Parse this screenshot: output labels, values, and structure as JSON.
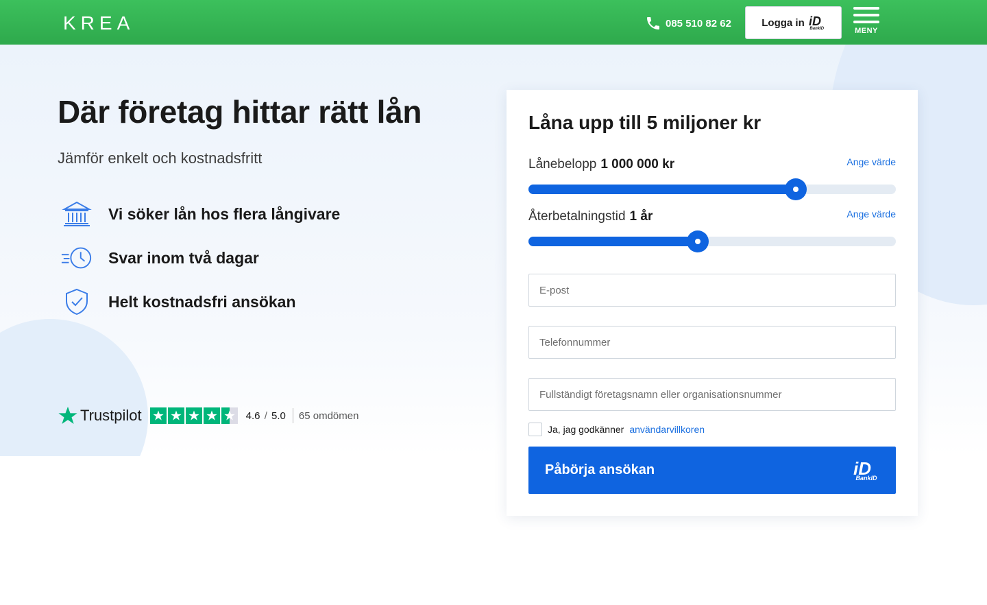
{
  "header": {
    "logo": "KREA",
    "phone": "085 510 82 62",
    "login_label": "Logga in",
    "login_badge_text": "BankID",
    "menu_label": "MENY"
  },
  "hero": {
    "title": "Där företag hittar rätt lån",
    "subtitle": "Jämför enkelt och kostnadsfritt",
    "features": [
      {
        "icon": "bank-icon",
        "text": "Vi söker lån hos flera långivare"
      },
      {
        "icon": "clock-icon",
        "text": "Svar inom två dagar"
      },
      {
        "icon": "shield-check-icon",
        "text": "Helt kostnadsfri ansökan"
      }
    ]
  },
  "trustpilot": {
    "brand": "Trustpilot",
    "rating": "4.6",
    "slash": "/",
    "max": "5.0",
    "reviews": "65 omdömen",
    "stars": 4.5
  },
  "form": {
    "title": "Låna upp till 5 miljoner kr",
    "amount": {
      "label": "Lånebelopp",
      "value": "1 000 000 kr",
      "action": "Ange värde",
      "position": 0.727
    },
    "term": {
      "label": "Återbetalningstid",
      "value": "1 år",
      "action": "Ange värde",
      "position": 0.46
    },
    "email_placeholder": "E-post",
    "phone_placeholder": "Telefonnummer",
    "company_placeholder": "Fullständigt företagsnamn eller organisationsnummer",
    "consent_text": "Ja, jag godkänner",
    "consent_link": "användarvillkoren",
    "submit_label": "Påbörja ansökan",
    "submit_badge_text": "BankID"
  },
  "colors": {
    "header_green": "#34b555",
    "primary_blue": "#0f64e0",
    "link_blue": "#1a6fe0",
    "trustpilot_green": "#00b67a"
  }
}
